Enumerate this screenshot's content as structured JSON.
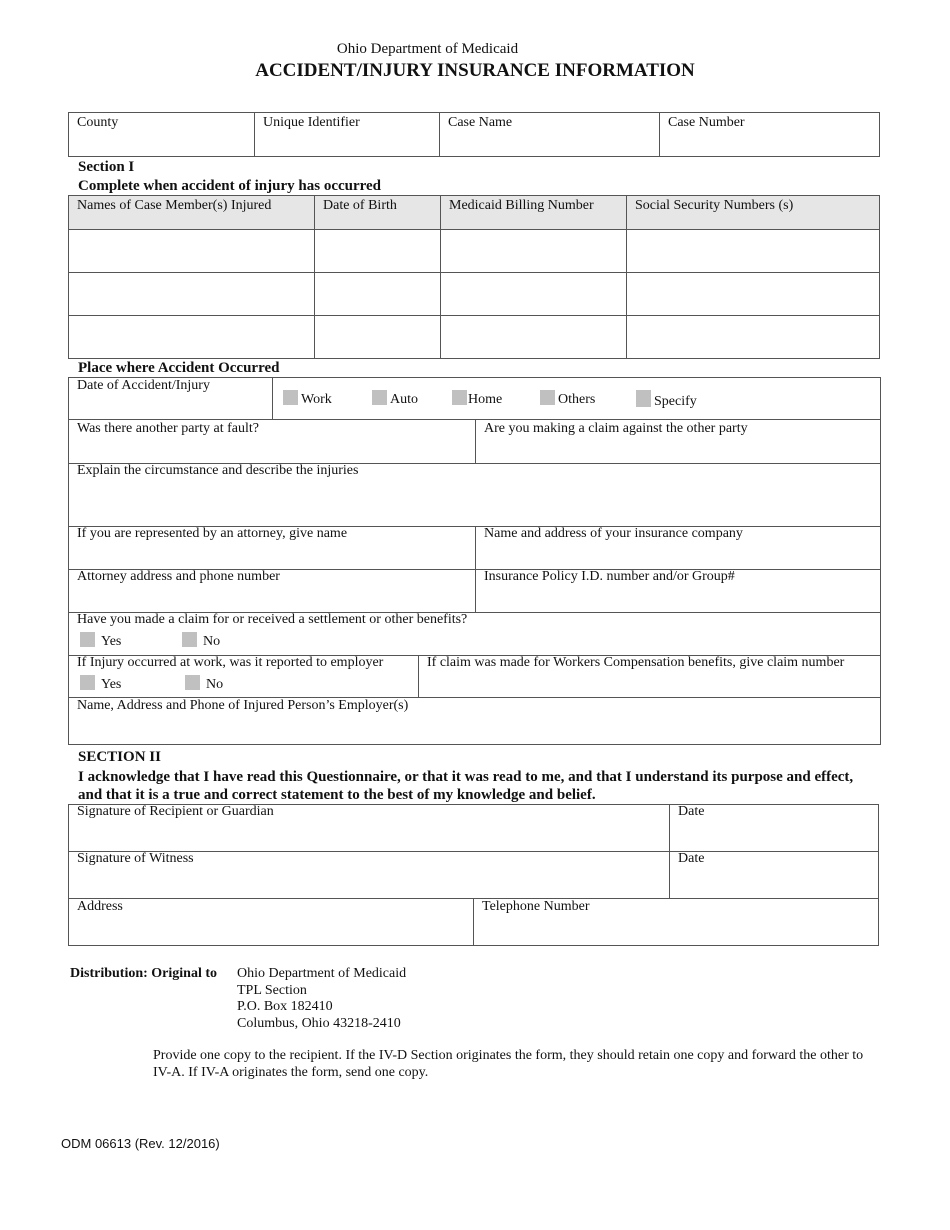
{
  "header": {
    "agency": "Ohio Department of Medicaid",
    "title": "ACCIDENT/INJURY INSURANCE INFORMATION"
  },
  "case_info": {
    "fields": [
      "County",
      "Unique Identifier",
      "Case Name",
      "Case Number"
    ]
  },
  "section1": {
    "heading": "Section I",
    "subheading": "Complete when accident of injury has occurred",
    "table": {
      "columns": [
        "Names of Case Member(s) Injured",
        "Date of Birth",
        "Medicaid Billing Number",
        "Social Security Numbers (s)"
      ],
      "rows": [
        [
          "",
          "",
          "",
          ""
        ],
        [
          "",
          "",
          "",
          ""
        ],
        [
          "",
          "",
          "",
          ""
        ]
      ]
    }
  },
  "place": {
    "heading": "Place where Accident Occurred",
    "date_label": "Date of Accident/Injury",
    "options": [
      "Work",
      "Auto",
      "Home",
      "Others",
      "Specify"
    ],
    "other_party_fault": "Was there another party at fault?",
    "claim_other_party": "Are you making a claim against the other party",
    "explain": "Explain the circumstance and describe the injuries",
    "attorney_name": "If you are represented by an attorney, give name",
    "insurance_company": "Name and address of your insurance company",
    "attorney_address": "Attorney address and phone number",
    "policy_id": "Insurance Policy I.D. number and/or Group#",
    "settlement_question": "Have you made a claim for or received a settlement or other benefits?",
    "settlement_options": [
      "Yes",
      "No"
    ],
    "reported_question": "If Injury occurred at work, was it reported to employer",
    "reported_options": [
      "Yes",
      "No"
    ],
    "workers_comp": "If claim was made for Workers Compensation benefits, give claim number",
    "employer": "Name, Address and Phone of Injured Person’s Employer(s)"
  },
  "section2": {
    "heading": "SECTION II",
    "acknowledgement": "I acknowledge that I have read this Questionnaire, or that it was read to me, and that I understand its purpose and effect, and that it is a true and correct statement to the best of my knowledge and belief.",
    "recipient_signature": "Signature of Recipient or Guardian",
    "date1": "Date",
    "witness_signature": "Signature of Witness",
    "date2": "Date",
    "address": "Address",
    "telephone": "Telephone Number"
  },
  "distribution": {
    "label": "Distribution: Original to",
    "address_lines": [
      "Ohio Department of Medicaid",
      "TPL Section",
      "P.O. Box 182410",
      "Columbus, Ohio 43218-2410"
    ],
    "instructions": "Provide one copy to the recipient. If the IV-D Section originates the form, they should retain one copy and forward the other to IV-A.  If IV-A originates the form, send one copy."
  },
  "footer": {
    "form_number": "ODM 06613 (Rev. 12/2016)"
  }
}
